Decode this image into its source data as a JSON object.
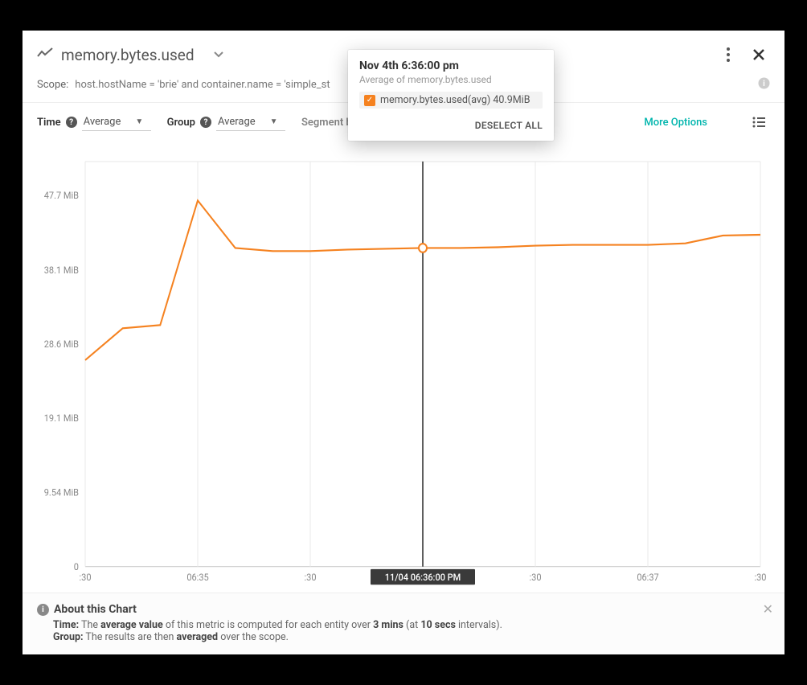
{
  "header": {
    "metric_title": "memory.bytes.used"
  },
  "scope": {
    "label": "Scope:",
    "value": "host.hostName = 'brie' and container.name = 'simple_st"
  },
  "controls": {
    "time_label": "Time",
    "time_value": "Average",
    "group_label": "Group",
    "group_value": "Average",
    "segment_label": "Segment by",
    "more_options": "More Options"
  },
  "tooltip": {
    "time": "Nov 4th 6:36:00 pm",
    "subtitle": "Average of memory.bytes.used",
    "series_label": "memory.bytes.used(avg) 40.9MiB",
    "deselect": "DESELECT ALL"
  },
  "about": {
    "title": "About this Chart",
    "time_label": "Time:",
    "time_text_1": "The ",
    "time_bold_1": "average value",
    "time_text_2": " of this metric is computed for each entity over ",
    "time_bold_2": "3 mins",
    "time_text_3": " (at ",
    "time_bold_3": "10 secs",
    "time_text_4": " intervals).",
    "group_label": "Group:",
    "group_text_1": "The results are then ",
    "group_bold_1": "averaged",
    "group_text_2": " over the scope."
  },
  "chart_data": {
    "type": "line",
    "title": "memory.bytes.used",
    "xlabel": "",
    "ylabel": "",
    "ylim": [
      0,
      52
    ],
    "y_ticks": [
      0,
      9.54,
      19.1,
      28.6,
      38.1,
      47.7
    ],
    "y_tick_labels": [
      "0",
      "9.54 MiB",
      "19.1 MiB",
      "28.6 MiB",
      "38.1 MiB",
      "47.7 MiB"
    ],
    "x_tick_labels": [
      ":30",
      "06:35",
      ":30",
      "11/04 06:36:00 PM",
      ":30",
      "06:37",
      ":30"
    ],
    "series": [
      {
        "name": "memory.bytes.used(avg)",
        "color": "#f58220",
        "x": [
          "06:34:30",
          "06:34:40",
          "06:34:50",
          "06:35:00",
          "06:35:10",
          "06:35:20",
          "06:35:30",
          "06:35:40",
          "06:35:50",
          "06:36:00",
          "06:36:10",
          "06:36:20",
          "06:36:30",
          "06:36:40",
          "06:36:50",
          "06:37:00",
          "06:37:10",
          "06:37:20",
          "06:37:30"
        ],
        "values": [
          26.5,
          30.6,
          31.0,
          47.0,
          40.9,
          40.5,
          40.5,
          40.7,
          40.8,
          40.9,
          40.9,
          41.0,
          41.2,
          41.3,
          41.3,
          41.3,
          41.5,
          42.5,
          42.6
        ]
      }
    ],
    "cursor": {
      "x_index": 9,
      "label": "11/04 06:36:00 PM",
      "value": 40.9
    }
  }
}
